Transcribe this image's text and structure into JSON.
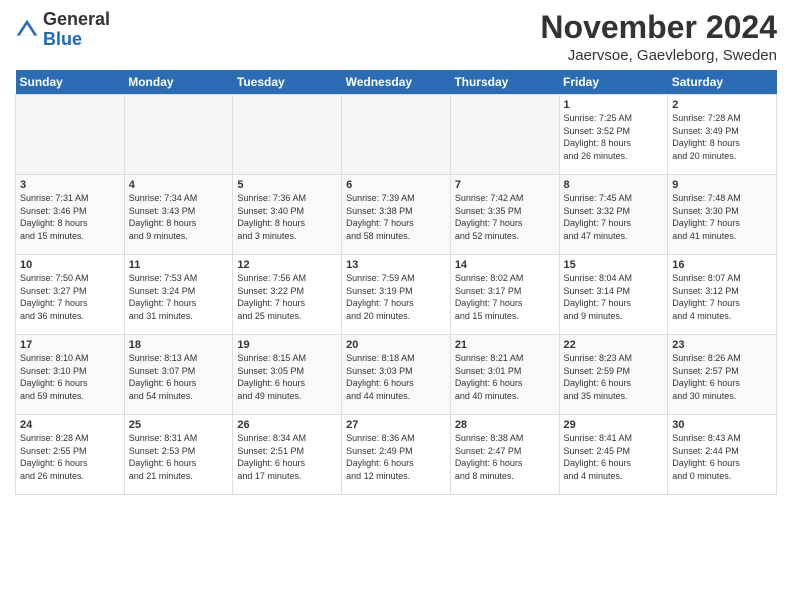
{
  "header": {
    "title": "November 2024",
    "location": "Jaervsoe, Gaevleborg, Sweden",
    "logo_general": "General",
    "logo_blue": "Blue"
  },
  "days_of_week": [
    "Sunday",
    "Monday",
    "Tuesday",
    "Wednesday",
    "Thursday",
    "Friday",
    "Saturday"
  ],
  "weeks": [
    [
      {
        "day": "",
        "info": ""
      },
      {
        "day": "",
        "info": ""
      },
      {
        "day": "",
        "info": ""
      },
      {
        "day": "",
        "info": ""
      },
      {
        "day": "",
        "info": ""
      },
      {
        "day": "1",
        "info": "Sunrise: 7:25 AM\nSunset: 3:52 PM\nDaylight: 8 hours\nand 26 minutes."
      },
      {
        "day": "2",
        "info": "Sunrise: 7:28 AM\nSunset: 3:49 PM\nDaylight: 8 hours\nand 20 minutes."
      }
    ],
    [
      {
        "day": "3",
        "info": "Sunrise: 7:31 AM\nSunset: 3:46 PM\nDaylight: 8 hours\nand 15 minutes."
      },
      {
        "day": "4",
        "info": "Sunrise: 7:34 AM\nSunset: 3:43 PM\nDaylight: 8 hours\nand 9 minutes."
      },
      {
        "day": "5",
        "info": "Sunrise: 7:36 AM\nSunset: 3:40 PM\nDaylight: 8 hours\nand 3 minutes."
      },
      {
        "day": "6",
        "info": "Sunrise: 7:39 AM\nSunset: 3:38 PM\nDaylight: 7 hours\nand 58 minutes."
      },
      {
        "day": "7",
        "info": "Sunrise: 7:42 AM\nSunset: 3:35 PM\nDaylight: 7 hours\nand 52 minutes."
      },
      {
        "day": "8",
        "info": "Sunrise: 7:45 AM\nSunset: 3:32 PM\nDaylight: 7 hours\nand 47 minutes."
      },
      {
        "day": "9",
        "info": "Sunrise: 7:48 AM\nSunset: 3:30 PM\nDaylight: 7 hours\nand 41 minutes."
      }
    ],
    [
      {
        "day": "10",
        "info": "Sunrise: 7:50 AM\nSunset: 3:27 PM\nDaylight: 7 hours\nand 36 minutes."
      },
      {
        "day": "11",
        "info": "Sunrise: 7:53 AM\nSunset: 3:24 PM\nDaylight: 7 hours\nand 31 minutes."
      },
      {
        "day": "12",
        "info": "Sunrise: 7:56 AM\nSunset: 3:22 PM\nDaylight: 7 hours\nand 25 minutes."
      },
      {
        "day": "13",
        "info": "Sunrise: 7:59 AM\nSunset: 3:19 PM\nDaylight: 7 hours\nand 20 minutes."
      },
      {
        "day": "14",
        "info": "Sunrise: 8:02 AM\nSunset: 3:17 PM\nDaylight: 7 hours\nand 15 minutes."
      },
      {
        "day": "15",
        "info": "Sunrise: 8:04 AM\nSunset: 3:14 PM\nDaylight: 7 hours\nand 9 minutes."
      },
      {
        "day": "16",
        "info": "Sunrise: 8:07 AM\nSunset: 3:12 PM\nDaylight: 7 hours\nand 4 minutes."
      }
    ],
    [
      {
        "day": "17",
        "info": "Sunrise: 8:10 AM\nSunset: 3:10 PM\nDaylight: 6 hours\nand 59 minutes."
      },
      {
        "day": "18",
        "info": "Sunrise: 8:13 AM\nSunset: 3:07 PM\nDaylight: 6 hours\nand 54 minutes."
      },
      {
        "day": "19",
        "info": "Sunrise: 8:15 AM\nSunset: 3:05 PM\nDaylight: 6 hours\nand 49 minutes."
      },
      {
        "day": "20",
        "info": "Sunrise: 8:18 AM\nSunset: 3:03 PM\nDaylight: 6 hours\nand 44 minutes."
      },
      {
        "day": "21",
        "info": "Sunrise: 8:21 AM\nSunset: 3:01 PM\nDaylight: 6 hours\nand 40 minutes."
      },
      {
        "day": "22",
        "info": "Sunrise: 8:23 AM\nSunset: 2:59 PM\nDaylight: 6 hours\nand 35 minutes."
      },
      {
        "day": "23",
        "info": "Sunrise: 8:26 AM\nSunset: 2:57 PM\nDaylight: 6 hours\nand 30 minutes."
      }
    ],
    [
      {
        "day": "24",
        "info": "Sunrise: 8:28 AM\nSunset: 2:55 PM\nDaylight: 6 hours\nand 26 minutes."
      },
      {
        "day": "25",
        "info": "Sunrise: 8:31 AM\nSunset: 2:53 PM\nDaylight: 6 hours\nand 21 minutes."
      },
      {
        "day": "26",
        "info": "Sunrise: 8:34 AM\nSunset: 2:51 PM\nDaylight: 6 hours\nand 17 minutes."
      },
      {
        "day": "27",
        "info": "Sunrise: 8:36 AM\nSunset: 2:49 PM\nDaylight: 6 hours\nand 12 minutes."
      },
      {
        "day": "28",
        "info": "Sunrise: 8:38 AM\nSunset: 2:47 PM\nDaylight: 6 hours\nand 8 minutes."
      },
      {
        "day": "29",
        "info": "Sunrise: 8:41 AM\nSunset: 2:45 PM\nDaylight: 6 hours\nand 4 minutes."
      },
      {
        "day": "30",
        "info": "Sunrise: 8:43 AM\nSunset: 2:44 PM\nDaylight: 6 hours\nand 0 minutes."
      }
    ]
  ]
}
